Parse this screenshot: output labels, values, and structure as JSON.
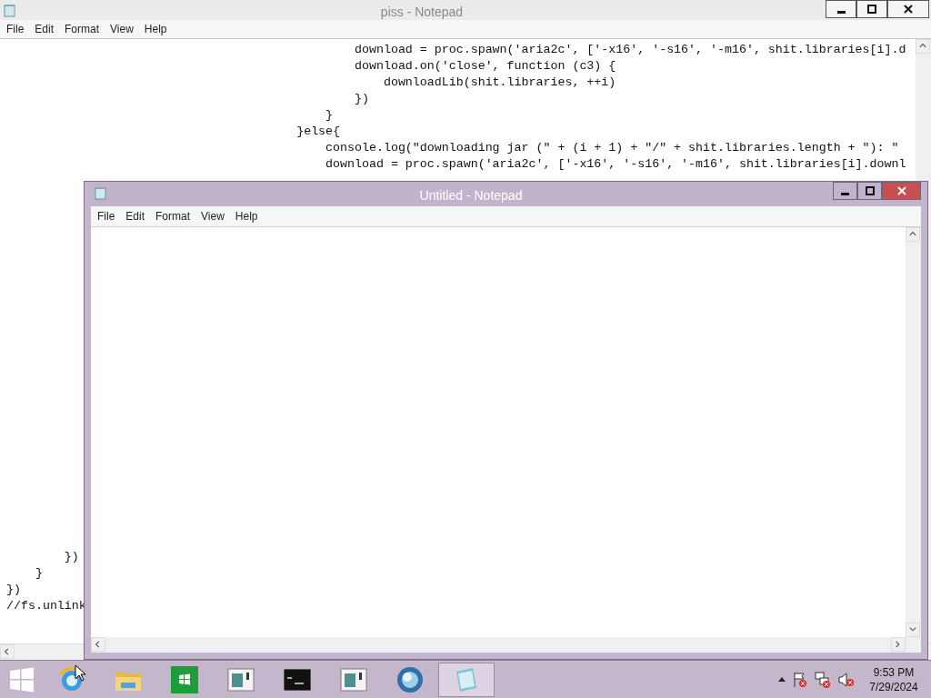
{
  "background_window": {
    "title": "piss - Notepad",
    "active": false,
    "menu": [
      "File",
      "Edit",
      "Format",
      "View",
      "Help"
    ],
    "top_lines": [
      "                                                download = proc.spawn('aria2c', ['-x16', '-s16', '-m16', shit.libraries[i].d",
      "                                                download.on('close', function (c3) {",
      "                                                    downloadLib(shit.libraries, ++i)",
      "                                                })",
      "                                            }",
      "                                        }else{",
      "                                            console.log(\"downloading jar (\" + (i + 1) + \"/\" + shit.libraries.length + \"): \"",
      "                                            download = proc.spawn('aria2c', ['-x16', '-s16', '-m16', shit.libraries[i].downl"
    ],
    "bottom_lines": [
      "        })",
      "    }",
      "})",
      "//fs.unlink"
    ]
  },
  "foreground_window": {
    "title": "Untitled - Notepad",
    "active": true,
    "menu": [
      "File",
      "Edit",
      "Format",
      "View",
      "Help"
    ]
  },
  "taskbar": {
    "items": [
      {
        "kind": "start",
        "selected": false
      },
      {
        "kind": "browser",
        "selected": false
      },
      {
        "kind": "folder",
        "selected": false
      },
      {
        "kind": "store",
        "selected": false
      },
      {
        "kind": "window",
        "selected": false
      },
      {
        "kind": "console",
        "selected": false
      },
      {
        "kind": "window",
        "selected": false
      },
      {
        "kind": "globe",
        "selected": false
      },
      {
        "kind": "notepad",
        "selected": true
      }
    ],
    "tray": [
      {
        "kind": "caret"
      },
      {
        "kind": "flag"
      },
      {
        "kind": "network"
      },
      {
        "kind": "sound"
      }
    ],
    "time": "9:53 PM",
    "date": "7/29/2024"
  }
}
